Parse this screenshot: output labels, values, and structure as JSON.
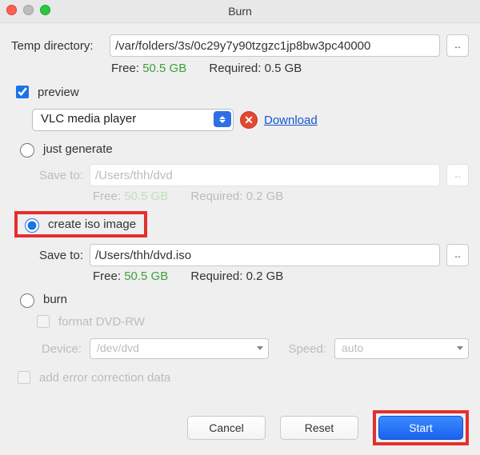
{
  "window": {
    "title": "Burn"
  },
  "temp": {
    "label": "Temp directory:",
    "value": "/var/folders/3s/0c29y7y90tzgzc1jp8bw3pc40000",
    "browse": "..",
    "free_label": "Free:",
    "free_value": "50.5 GB",
    "req_label": "Required:",
    "req_value": "0.5 GB"
  },
  "preview": {
    "label": "preview",
    "checked": true,
    "player": "VLC media player",
    "download": "Download"
  },
  "modes": {
    "just_generate": {
      "label": "just generate",
      "save_label": "Save to:",
      "save_value": "/Users/thh/dvd",
      "browse": "..",
      "free_label": "Free:",
      "free_value": "50.5 GB",
      "req_label": "Required:",
      "req_value": "0.2 GB"
    },
    "create_iso": {
      "label": "create iso image",
      "save_label": "Save to:",
      "save_value": "/Users/thh/dvd.iso",
      "browse": "..",
      "free_label": "Free:",
      "free_value": "50.5 GB",
      "req_label": "Required:",
      "req_value": "0.2 GB"
    },
    "burn": {
      "label": "burn",
      "format_label": "format DVD-RW",
      "device_label": "Device:",
      "device_value": "/dev/dvd",
      "speed_label": "Speed:",
      "speed_value": "auto"
    }
  },
  "ecc": {
    "label": "add error correction data"
  },
  "buttons": {
    "cancel": "Cancel",
    "reset": "Reset",
    "start": "Start"
  }
}
